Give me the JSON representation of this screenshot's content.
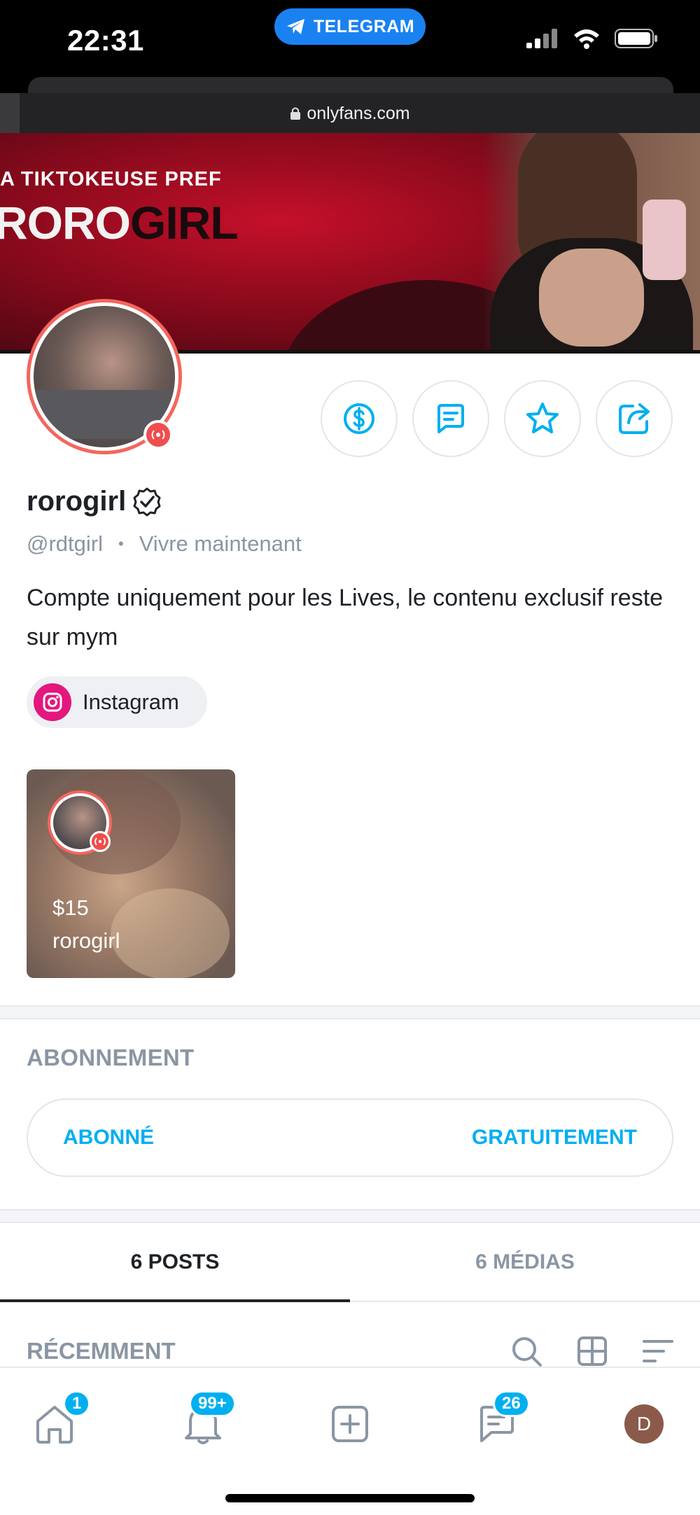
{
  "status_bar": {
    "time": "22:31",
    "telegram_label": "TELEGRAM"
  },
  "browser": {
    "url": "onlyfans.com"
  },
  "banner": {
    "subtitle": "A TIKTOKEUSE PREF",
    "title_light": "ORO",
    "title_dark": "GIRL",
    "title_leading": "R"
  },
  "profile": {
    "name": "rorogirl",
    "handle": "@rdtgirl",
    "separator": "•",
    "status": "Vivre maintenant",
    "bio": "Compte uniquement pour les Lives, le contenu exclusif reste sur mym",
    "verified_icon": "verified-badge-icon",
    "live_icon": "live-broadcast-icon"
  },
  "actions": [
    {
      "name": "tip-button",
      "icon": "dollar-icon"
    },
    {
      "name": "message-button",
      "icon": "chat-icon"
    },
    {
      "name": "favorite-button",
      "icon": "star-icon"
    },
    {
      "name": "share-button",
      "icon": "share-icon"
    }
  ],
  "social": {
    "instagram_label": "Instagram"
  },
  "stream_card": {
    "price": "$15",
    "username": "rorogirl"
  },
  "subscription": {
    "section_title": "ABONNEMENT",
    "left_label": "ABONNÉ",
    "right_label": "GRATUITEMENT"
  },
  "tabs": {
    "posts": "6 POSTS",
    "media": "6 MÉDIAS",
    "active": "posts"
  },
  "feed": {
    "sort_label": "RÉCEMMENT"
  },
  "bottom_nav": {
    "home_badge": "1",
    "notifications_badge": "99+",
    "messages_badge": "26",
    "avatar_initial": "D"
  },
  "colors": {
    "accent": "#00aff0",
    "live_red": "#f04d4d",
    "avatar_ring": "#f4665e",
    "instagram": "#e3177e"
  }
}
